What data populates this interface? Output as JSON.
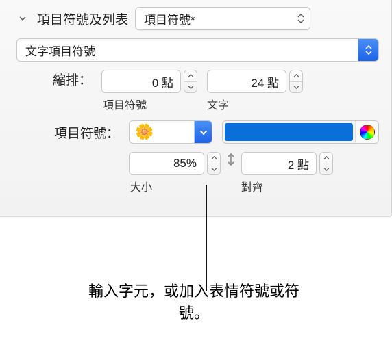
{
  "header": {
    "section_label": "項目符號及列表",
    "style_select": "項目符號*"
  },
  "bullet_type_select": "文字項目符號",
  "indent": {
    "label": "縮排：",
    "bullet_value": "0 點",
    "bullet_caption": "項目符號",
    "text_value": "24 點",
    "text_caption": "文字"
  },
  "bullet": {
    "label": "項目符號：",
    "symbol": "🌼",
    "color": "#0a6fd8",
    "size_value": "85%",
    "size_caption": "大小",
    "align_value": "2 點",
    "align_caption": "對齊"
  },
  "callout": "輸入字元，或加入表情符號或符號。"
}
